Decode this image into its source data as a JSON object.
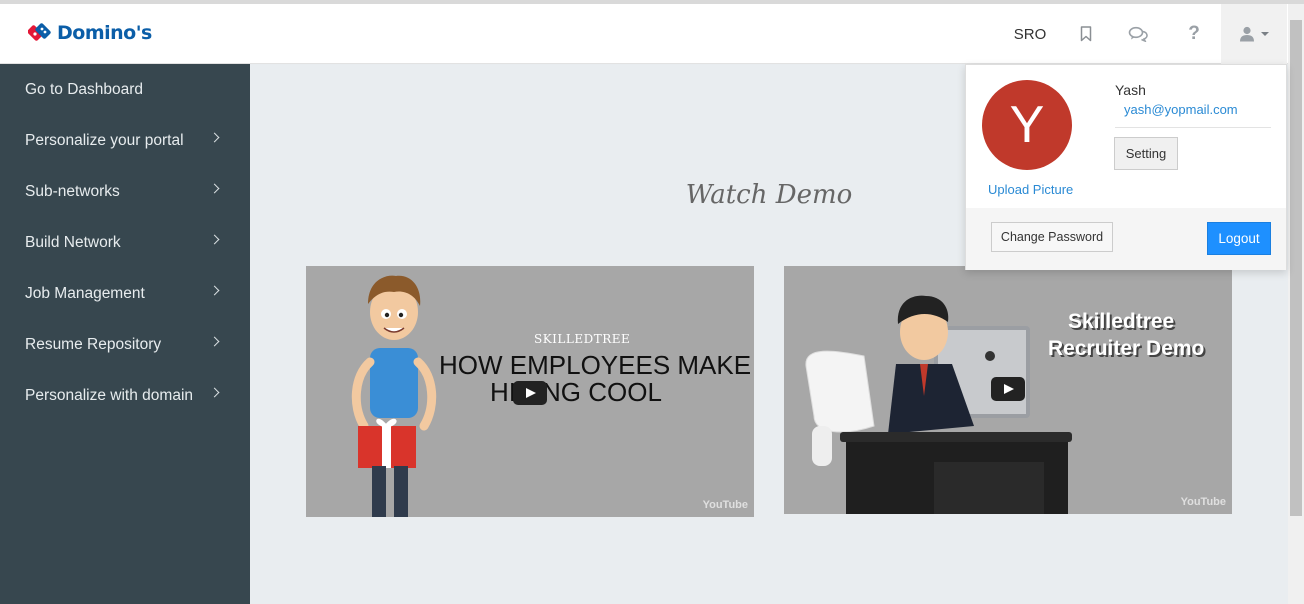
{
  "header": {
    "logo_text": "Domino's",
    "org_label": "SRO",
    "icons": [
      "dominos-logo-icon",
      "bookmark-icon",
      "chat-icon",
      "help-icon",
      "user-icon",
      "caret-down-icon"
    ],
    "help_glyph": "?"
  },
  "sidebar": {
    "items": [
      {
        "label": "Go to Dashboard",
        "has_submenu": false
      },
      {
        "label": "Personalize your portal",
        "has_submenu": true
      },
      {
        "label": "Sub-networks",
        "has_submenu": true
      },
      {
        "label": "Build Network",
        "has_submenu": true
      },
      {
        "label": "Job Management",
        "has_submenu": true
      },
      {
        "label": "Resume Repository",
        "has_submenu": true
      },
      {
        "label": "Personalize with domain",
        "has_submenu": true
      }
    ]
  },
  "main": {
    "title": "Watch Demo",
    "videos": [
      {
        "brand": "SKILLEDTREE",
        "lines": [
          "HOW EMPLOYEES MAKE",
          "HIRING COOL"
        ],
        "watermark": "YouTube"
      },
      {
        "lines": [
          "Skilledtree",
          "Recruiter Demo"
        ],
        "watermark": "YouTube"
      }
    ]
  },
  "user_menu": {
    "avatar_initial": "Y",
    "avatar_color": "#c0392b",
    "upload_label": "Upload Picture",
    "name": "Yash",
    "email": "yash@yopmail.com",
    "setting_label": "Setting",
    "change_password_label": "Change Password",
    "logout_label": "Logout"
  },
  "colors": {
    "sidebar_bg": "#37474f",
    "accent_blue": "#1e90ff",
    "link_blue": "#2a8ad4",
    "brand_blue": "#0b5ea8"
  }
}
